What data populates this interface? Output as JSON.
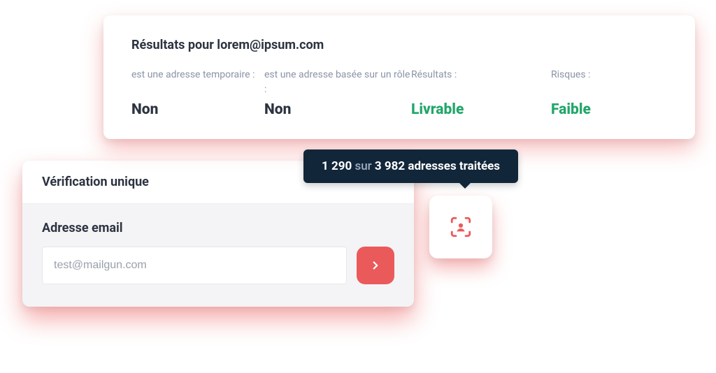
{
  "results": {
    "title": "Résultats pour lorem@ipsum.com",
    "cols": [
      {
        "label": "est une adresse temporaire :",
        "value": "Non",
        "style": "dark"
      },
      {
        "label": "est une adresse basée sur un rôle :",
        "value": "Non",
        "style": "dark"
      },
      {
        "label": "Résultats :",
        "value": "Livrable",
        "style": "green"
      },
      {
        "label": "Risques :",
        "value": "Faible",
        "style": "green"
      }
    ]
  },
  "tooltip": {
    "processed": "1 290",
    "joiner": "sur",
    "total": "3 982",
    "suffix": "adresses traitées"
  },
  "verify": {
    "header": "Vérification unique",
    "label": "Adresse email",
    "value": "test@mailgun.com"
  },
  "colors": {
    "accent": "#ea5a5a",
    "success": "#21a66a",
    "dark_tooltip": "#12263a"
  }
}
